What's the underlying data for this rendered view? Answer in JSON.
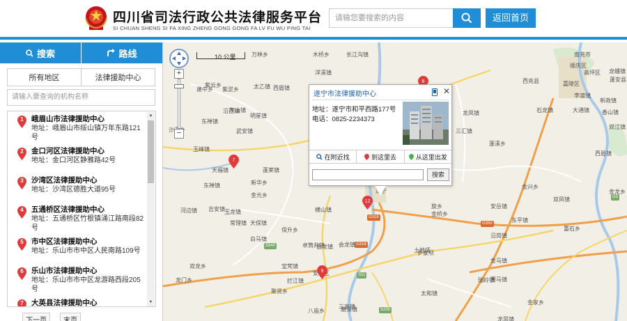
{
  "header": {
    "title": "四川省司法行政公共法律服务平台",
    "subtitle": "SI CHUAN SHENG SI FA XING ZHENG GONG GONG FA LV FU WU PING TAI",
    "search_placeholder": "请输您要搜索的内容",
    "home_label": "返回首页",
    "brand_color": "#1f8ed6"
  },
  "sidebar": {
    "tabs": [
      {
        "label": "搜索",
        "icon": "search-icon"
      },
      {
        "label": "路线",
        "icon": "route-icon"
      }
    ],
    "filters": [
      "所有地区",
      "法律援助中心"
    ],
    "org_search_placeholder": "请输入要查询的机构名称",
    "items": [
      {
        "num": "1",
        "name": "峨眉山市法律援助中心",
        "addr": "地址：峨眉山市绥山镇万年东路121号"
      },
      {
        "num": "2",
        "name": "金口河区法律援助中心",
        "addr": "地址：金口河区静雅路42号"
      },
      {
        "num": "3",
        "name": "沙湾区法律援助中心",
        "addr": "地址：沙湾区德胜大道95号"
      },
      {
        "num": "4",
        "name": "五通桥区法律援助中心",
        "addr": "地址：五通桥区竹根镇涌江路南段82号"
      },
      {
        "num": "5",
        "name": "市中区法律援助中心",
        "addr": "地址：乐山市市中区人民南路109号"
      },
      {
        "num": "6",
        "name": "乐山市法律援助中心",
        "addr": "地址：乐山市市中区龙游路西段205号"
      },
      {
        "num": "7",
        "name": "大英县法律援助中心",
        "addr": ""
      }
    ],
    "pager": {
      "next": "下一页",
      "last": "末页"
    }
  },
  "map": {
    "scale_label": "10 公里",
    "labels": [
      {
        "text": "万林乡"
      },
      {
        "text": "木桥乡"
      },
      {
        "text": "长江沟镇"
      },
      {
        "text": "洋溪镇"
      },
      {
        "text": "紫云乡"
      },
      {
        "text": "建中乡"
      },
      {
        "text": "紫淤乡"
      },
      {
        "text": "太乙镇"
      },
      {
        "text": "沙溪乡"
      },
      {
        "text": "灰山镇"
      },
      {
        "text": "明星镇"
      },
      {
        "text": "沿西镇"
      },
      {
        "text": "东禅镇"
      },
      {
        "text": "玉峰镇"
      },
      {
        "text": "武安镇"
      },
      {
        "text": "天福镇"
      },
      {
        "text": "蓬莱镇"
      },
      {
        "text": "新华乡"
      },
      {
        "text": "金元乡"
      },
      {
        "text": "河边镇"
      },
      {
        "text": "吉安镇"
      },
      {
        "text": "天保镇"
      },
      {
        "text": "横山镇"
      },
      {
        "text": "卓筒井镇"
      },
      {
        "text": "玉龙镇"
      },
      {
        "text": "白马镇"
      },
      {
        "text": "双龙乡"
      },
      {
        "text": "保升乡"
      },
      {
        "text": "会龙镇"
      },
      {
        "text": "安居区"
      },
      {
        "text": "三家镇"
      },
      {
        "text": "磨溪镇"
      },
      {
        "text": "拦江镇"
      },
      {
        "text": "宝梵镇"
      },
      {
        "text": "八庙乡"
      },
      {
        "text": "龙门乡"
      },
      {
        "text": "聚贤乡"
      },
      {
        "text": "东禅镇"
      },
      {
        "text": "西眉镇"
      },
      {
        "text": "常理镇"
      },
      {
        "text": "西充县"
      },
      {
        "text": "南充市"
      },
      {
        "text": "顺庆区"
      },
      {
        "text": "嘉陵区"
      },
      {
        "text": "高坪区"
      },
      {
        "text": "李渡镇"
      },
      {
        "text": "龙蟠镇"
      },
      {
        "text": "蓬安县"
      },
      {
        "text": "大通镇"
      },
      {
        "text": "新政镇"
      },
      {
        "text": "石龙镇"
      },
      {
        "text": "金兴乡"
      },
      {
        "text": "双凤镇"
      },
      {
        "text": "蓬溪乡"
      },
      {
        "text": "安岳镇"
      },
      {
        "text": "重石乡"
      },
      {
        "text": "金马镇"
      },
      {
        "text": "旋乡"
      },
      {
        "text": "瑞岭镇"
      },
      {
        "text": "赛马镇"
      },
      {
        "text": "三汇镇"
      },
      {
        "text": "金桥乡"
      },
      {
        "text": "东平镇"
      },
      {
        "text": "土地垭"
      },
      {
        "text": "罗家坝"
      },
      {
        "text": "太和镇"
      },
      {
        "text": "遂宁"
      },
      {
        "text": "会龙镇"
      },
      {
        "text": "香山镇"
      },
      {
        "text": "双江镇"
      },
      {
        "text": "龙凤镇"
      },
      {
        "text": "沿岗镇"
      },
      {
        "text": "西眉镇"
      },
      {
        "text": "金龙乡"
      },
      {
        "text": "金家乡"
      },
      {
        "text": "龙凤镇"
      }
    ],
    "shields": [
      "G5",
      "G318",
      "S205",
      "G350",
      "S540",
      "G318",
      "S11"
    ],
    "info": {
      "title": "遂宁市法律援助中心",
      "addr": "地址：遂宁市和平西路177号",
      "tel": "电话：0825-2234373",
      "tabs": [
        "在附近找",
        "到这里去",
        "从这里出发"
      ],
      "search_btn": "搜索"
    }
  }
}
